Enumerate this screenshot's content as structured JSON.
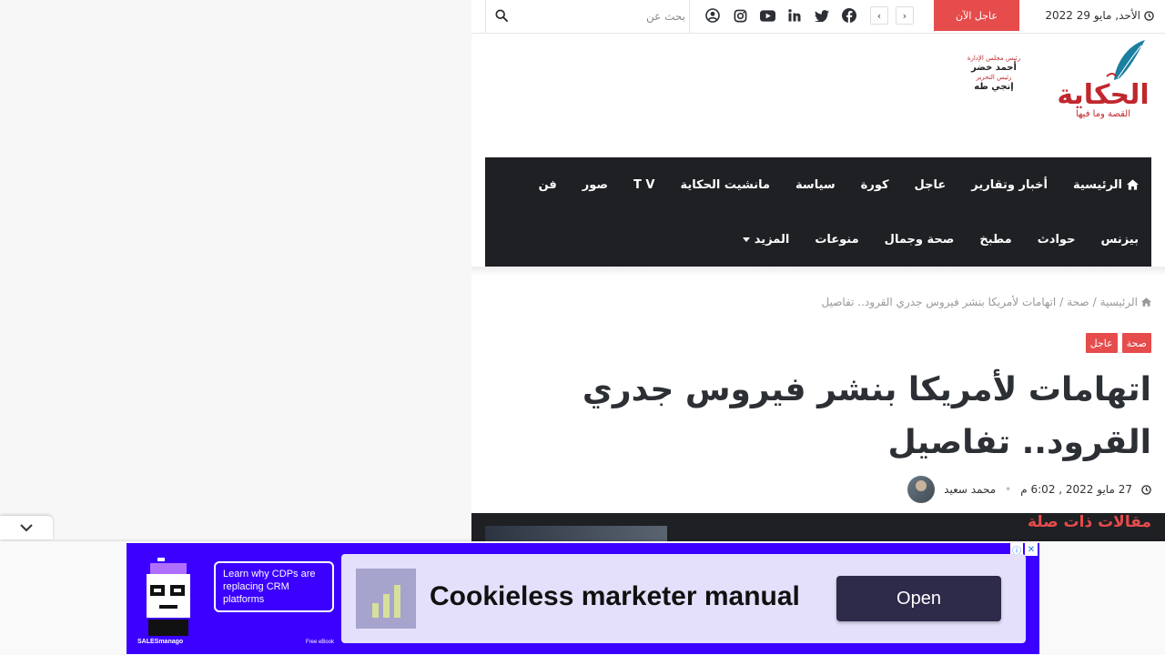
{
  "topbar": {
    "date": "الأحد, مايو 29 2022",
    "breaking_label": "عاجل الآن",
    "search_placeholder": "بحث عن",
    "prev_arrow": "‹",
    "next_arrow": "›"
  },
  "header": {
    "editors": [
      {
        "role": "رئيس مجلس الإدارة",
        "name": "أحمد خضر"
      },
      {
        "role": "رئيس التحرير",
        "name": "إنجي طه"
      }
    ],
    "logo_text": "الحكاية",
    "logo_slogan": "القصة وما فيها"
  },
  "nav": {
    "row1": [
      "الرئيسية",
      "أخبار وتقارير",
      "عاجل",
      "كورة",
      "سياسة",
      "مانشيت الحكاية",
      "T V",
      "صور",
      "فن"
    ],
    "row2": [
      "بيزنس",
      "حوادث",
      "مطبخ",
      "صحة وجمال",
      "منوعات",
      "المزيد"
    ]
  },
  "breadcrumb": {
    "home": "الرئيسية",
    "sep": "/",
    "section": "صحة",
    "current": "اتهامات لأمريكا بنشر فيروس جدري القرود.. تفاصيل"
  },
  "categories": [
    "صحة",
    "عاجل"
  ],
  "article": {
    "title": "اتهامات لأمريكا بنشر فيروس جدري القرود.. تفاصيل",
    "author": "محمد سعيد",
    "date": "27 مايو 2022 , 6:02 م"
  },
  "related_title": "مقالات ذات صلة",
  "ad": {
    "cdp_text": "Learn why CDPs are replacing CRM platforms",
    "brand": "SALESmanago",
    "ebook": "Free eBook",
    "headline": "Cookieless marketer manual",
    "cta": "Open"
  },
  "colors": {
    "accent": "#e64c4c",
    "nav_bg": "#1f2024",
    "ad_bg": "#3b00ff"
  }
}
